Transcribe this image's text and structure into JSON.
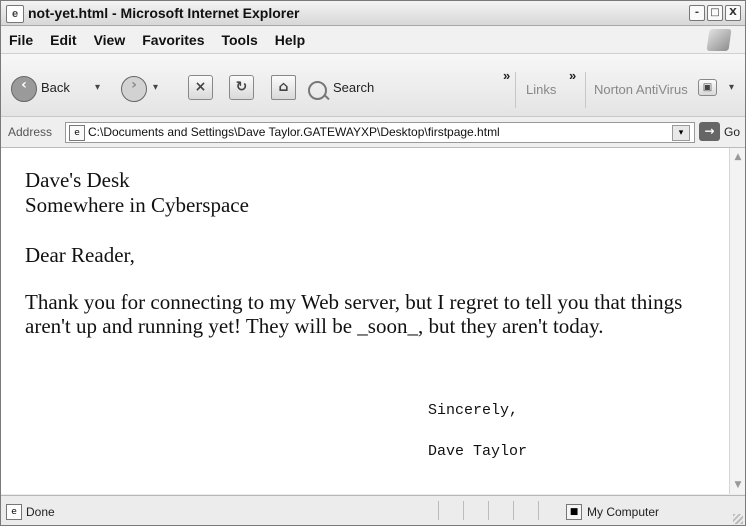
{
  "window": {
    "title": "not-yet.html - Microsoft Internet Explorer",
    "controls": {
      "minimize": "-",
      "maximize": "□",
      "close": "X"
    }
  },
  "menu": {
    "items": [
      "File",
      "Edit",
      "View",
      "Favorites",
      "Tools",
      "Help"
    ]
  },
  "toolbar": {
    "back_label": "Back",
    "back_icon": "back-arrow",
    "forward_icon": "forward-arrow",
    "stop_icon": "stop",
    "refresh_icon": "refresh",
    "home_icon": "home",
    "search_label": "Search",
    "search_icon": "magnifier",
    "more_left": "»",
    "links_label": "Links",
    "more_right": "»",
    "norton_label": "Norton AntiVirus",
    "norton_icon": "norton"
  },
  "address_bar": {
    "label": "Address",
    "url": "C:\\Documents and Settings\\Dave Taylor.GATEWAYXP\\Desktop\\firstpage.html",
    "go_label": "Go",
    "go_icon": "go-arrow"
  },
  "content": {
    "heading_lines": [
      "Dave's Desk",
      "Somewhere in Cyberspace"
    ],
    "greeting": "Dear Reader,",
    "paragraph": "Thank you for connecting to my Web server, but I regret to tell you that things aren't up and running yet! They will be _soon_, but they aren't today.",
    "closing": "Sincerely,",
    "signature": "Dave Taylor"
  },
  "status_bar": {
    "status": "Done",
    "zone": "My Computer"
  }
}
